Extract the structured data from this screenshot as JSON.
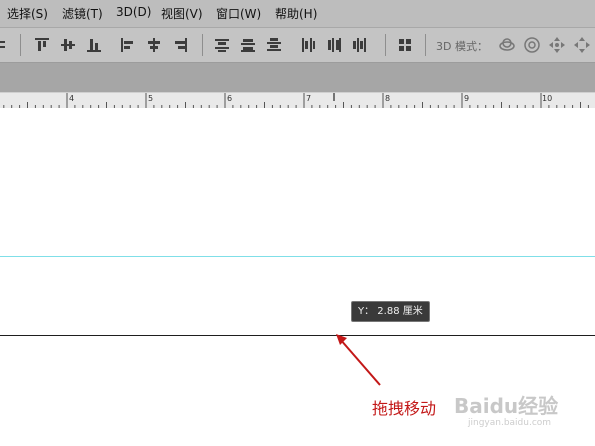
{
  "menu": {
    "items": [
      {
        "label": "选择(S)"
      },
      {
        "label": "滤镜(T)"
      },
      {
        "label": "3D(D)"
      },
      {
        "label": "视图(V)"
      },
      {
        "label": "窗口(W)"
      },
      {
        "label": "帮助(H)"
      }
    ]
  },
  "options_bar": {
    "mode_label": "3D 模式：",
    "align_icons": [
      "align-top-edges-icon",
      "align-vertical-centers-icon",
      "align-bottom-edges-icon",
      "align-left-edges-icon",
      "align-horizontal-centers-icon",
      "align-right-edges-icon",
      "distribute-top-icon",
      "distribute-vertical-centers-icon",
      "distribute-bottom-icon",
      "distribute-left-icon",
      "distribute-horizontal-centers-icon",
      "distribute-right-icon",
      "auto-align-layers-icon"
    ],
    "mode_icons": [
      "rotate-3d-icon",
      "roll-3d-icon",
      "pan-3d-icon",
      "slide-3d-icon"
    ]
  },
  "ruler": {
    "labels": [
      "4",
      "5",
      "6",
      "7",
      "8",
      "9",
      "10"
    ]
  },
  "tooltip": {
    "text": "Y： 2.88 厘米"
  },
  "annotation": {
    "text": "拖拽移动",
    "color": "#c31818"
  },
  "watermark": {
    "text": "Baidu经验",
    "sub": "jingyan.baidu.com"
  },
  "colors": {
    "guide_cyan": "#7fdfe8",
    "guide_dark": "#1e1e1e",
    "menubar": "#bdbdbd"
  }
}
